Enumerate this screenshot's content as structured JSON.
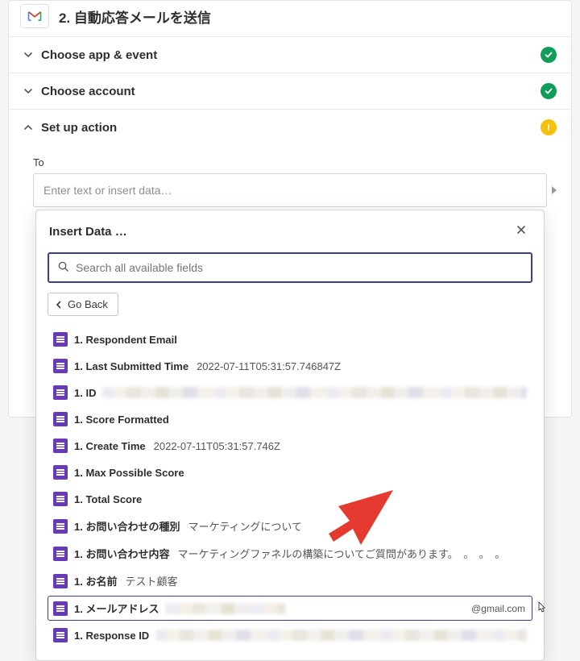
{
  "step": {
    "number": "2.",
    "title": "自動応答メールを送信"
  },
  "sections": {
    "choose_app": "Choose app & event",
    "choose_account": "Choose account",
    "setup_action": "Set up action"
  },
  "to_field": {
    "label": "To",
    "placeholder": "Enter text or insert data…"
  },
  "popover": {
    "title": "Insert Data …",
    "search_placeholder": "Search all available fields",
    "go_back": "Go Back",
    "fields": [
      {
        "name": "1. Respondent Email",
        "value": ""
      },
      {
        "name": "1. Last Submitted Time",
        "value": "2022-07-11T05:31:57.746847Z"
      },
      {
        "name": "1. ID",
        "value": "",
        "blurred": true
      },
      {
        "name": "1. Score Formatted",
        "value": ""
      },
      {
        "name": "1. Create Time",
        "value": "2022-07-11T05:31:57.746Z"
      },
      {
        "name": "1. Max Possible Score",
        "value": ""
      },
      {
        "name": "1. Total Score",
        "value": ""
      },
      {
        "name": "1. お問い合わせの種別",
        "value": "マーケティングについて"
      },
      {
        "name": "1. お問い合わせ内容",
        "value": "マーケティングファネルの構築についてご質問があります。　。　。　。"
      },
      {
        "name": "1. お名前",
        "value": "テスト顧客"
      },
      {
        "name": "1. メールアドレス",
        "value": "",
        "blurred_partial": true,
        "suffix": "@gmail.com",
        "selected": true
      },
      {
        "name": "1. Response ID",
        "value": "",
        "blurred": true
      }
    ]
  }
}
